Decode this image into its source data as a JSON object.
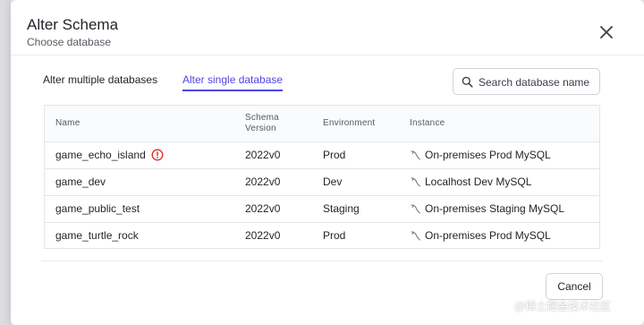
{
  "dialog": {
    "title": "Alter Schema",
    "subtitle": "Choose database"
  },
  "tabs": [
    {
      "label": "Alter multiple databases",
      "active": false
    },
    {
      "label": "Alter single database",
      "active": true
    }
  ],
  "search": {
    "placeholder": "Search database name",
    "value": ""
  },
  "table": {
    "headers": {
      "name": "Name",
      "schema_version": "Schema Version",
      "environment": "Environment",
      "instance": "Instance"
    },
    "rows": [
      {
        "name": "game_echo_island",
        "warning": true,
        "schema_version": "2022v0",
        "environment": "Prod",
        "instance": "On-premises Prod MySQL"
      },
      {
        "name": "game_dev",
        "warning": false,
        "schema_version": "2022v0",
        "environment": "Dev",
        "instance": "Localhost Dev MySQL"
      },
      {
        "name": "game_public_test",
        "warning": false,
        "schema_version": "2022v0",
        "environment": "Staging",
        "instance": "On-premises Staging MySQL"
      },
      {
        "name": "game_turtle_rock",
        "warning": false,
        "schema_version": "2022v0",
        "environment": "Prod",
        "instance": "On-premises Prod MySQL"
      }
    ]
  },
  "footer": {
    "cancel_label": "Cancel"
  },
  "watermark": {
    "text": "@稀土掘金技术社区"
  },
  "colors": {
    "accent": "#4f46e5",
    "warning": "#dc2626"
  },
  "icons": {
    "close": "close-icon",
    "search": "search-icon",
    "warning": "warning-icon",
    "instance": "mysql-icon"
  }
}
